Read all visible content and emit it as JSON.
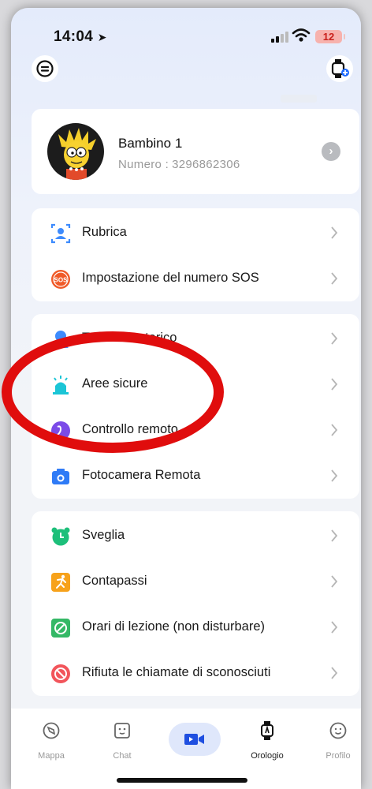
{
  "status": {
    "time": "14:04",
    "battery": "12"
  },
  "header": {
    "menu_icon": "menu-circle-icon",
    "watch_add_icon": "watch-add-icon"
  },
  "profile": {
    "name": "Bambino 1",
    "number_label": "Numero :",
    "number": "3296862306"
  },
  "groups": [
    {
      "items": [
        {
          "label": "Rubrica",
          "icon": "contacts-icon"
        },
        {
          "label": "Impostazione del numero SOS",
          "icon": "sos-icon"
        }
      ]
    },
    {
      "items": [
        {
          "label": "Tracciato storico",
          "icon": "history-track-icon"
        },
        {
          "label": "Aree sicure",
          "icon": "safe-area-icon"
        },
        {
          "label": "Controllo remoto",
          "icon": "remote-monitor-icon"
        },
        {
          "label": "Fotocamera Remota",
          "icon": "camera-icon"
        }
      ]
    },
    {
      "items": [
        {
          "label": "Sveglia",
          "icon": "alarm-icon"
        },
        {
          "label": "Contapassi",
          "icon": "pedometer-icon"
        },
        {
          "label": "Orari di lezione (non disturbare)",
          "icon": "class-time-icon"
        },
        {
          "label": "Rifiuta le chiamate di sconosciuti",
          "icon": "reject-call-icon"
        }
      ]
    }
  ],
  "tabbar": {
    "tabs": [
      {
        "label": "Mappa"
      },
      {
        "label": "Chat"
      },
      {
        "label": ""
      },
      {
        "label": "Orologio"
      },
      {
        "label": "Profilo"
      }
    ],
    "active": "Orologio"
  },
  "colors": {
    "highlight": "#e00d0d",
    "accent": "#1f6bff",
    "icon_blue": "#3d8bfd"
  }
}
